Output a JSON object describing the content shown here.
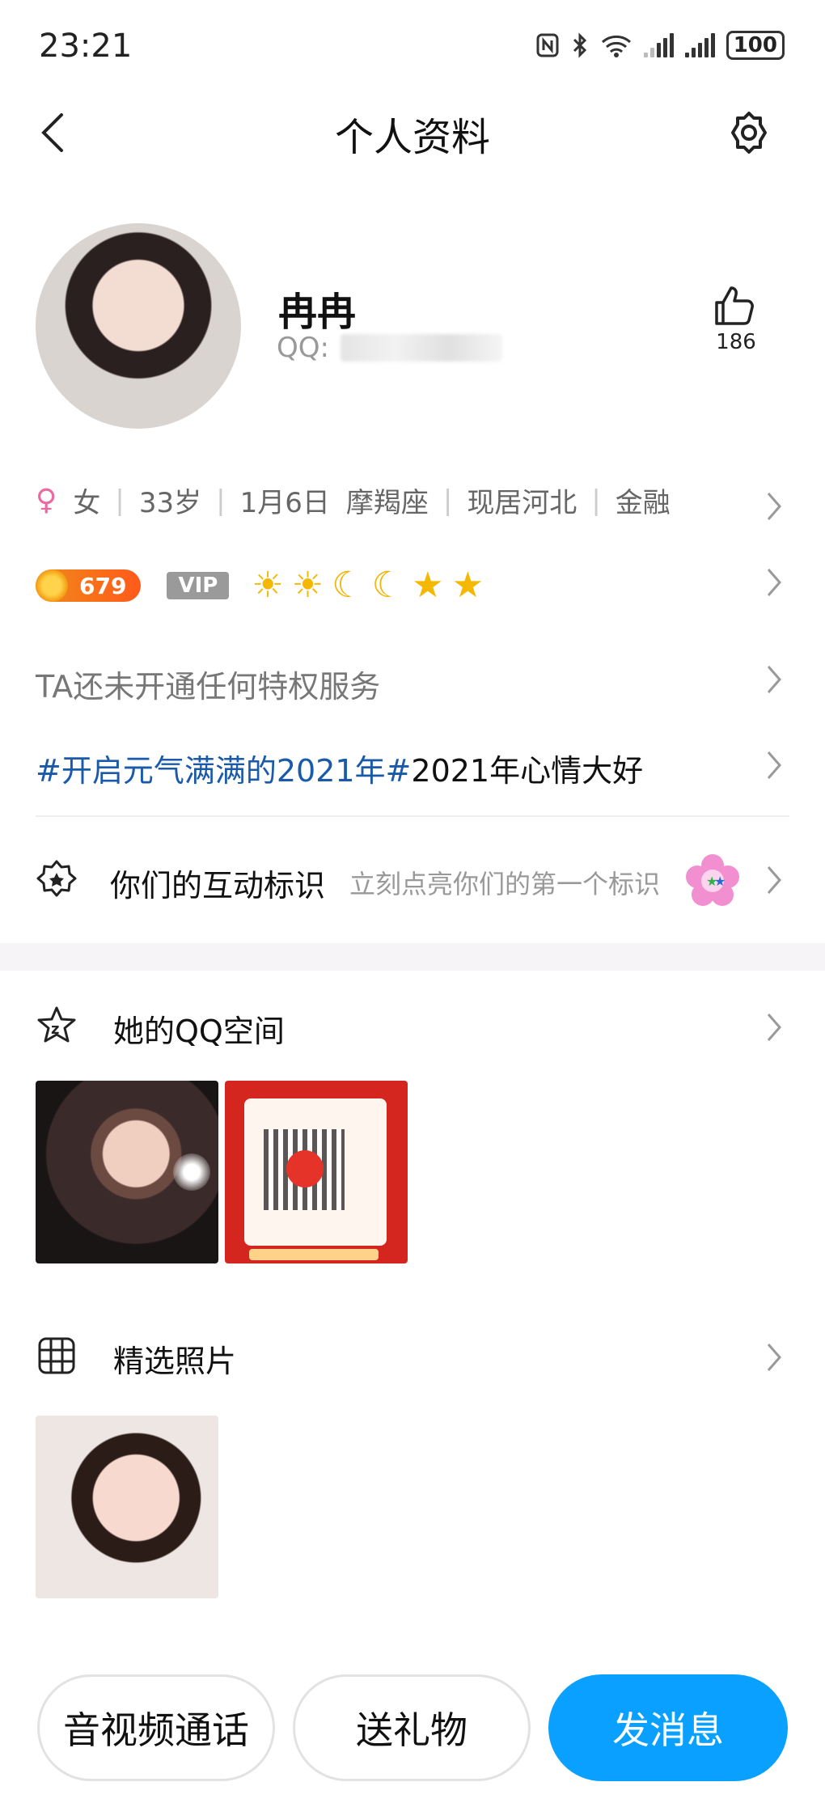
{
  "status_bar": {
    "time": "23:21",
    "battery": "100"
  },
  "header": {
    "title": "个人资料"
  },
  "profile": {
    "name": "冉冉",
    "qq_label": "QQ:",
    "likes": "186"
  },
  "info": {
    "gender_symbol": "♀",
    "items": [
      "女",
      "33岁",
      "1月6日",
      "摩羯座",
      "现居河北",
      "金融"
    ]
  },
  "level": {
    "coin_value": "679",
    "vip_label": "VIP"
  },
  "privilege_text": "TA还未开通任何特权服务",
  "signature": {
    "tag": "#开启元气满满的2021年#",
    "text": "2021年心情大好"
  },
  "interaction": {
    "label": "你们的互动标识",
    "hint": "立刻点亮你们的第一个标识"
  },
  "qzone": {
    "label": "她的QQ空间"
  },
  "photos": {
    "label": "精选照片"
  },
  "actions": {
    "call": "音视频通话",
    "gift": "送礼物",
    "message": "发消息"
  }
}
